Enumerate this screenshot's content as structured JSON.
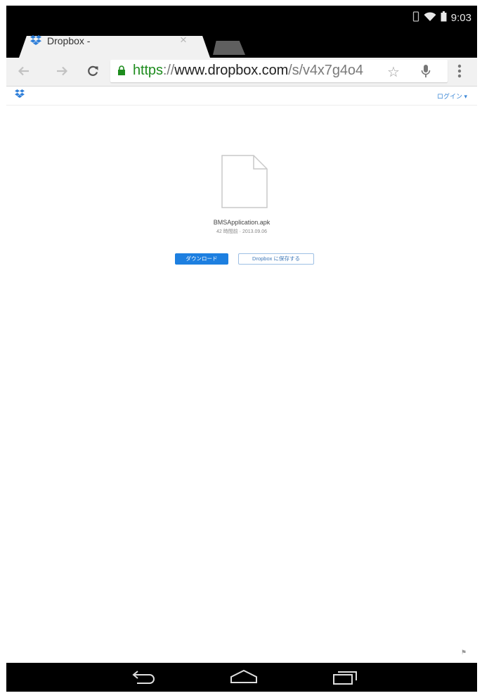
{
  "status_bar": {
    "time": "9:03",
    "icons": [
      "vibrate-icon",
      "wifi-icon",
      "battery-icon"
    ]
  },
  "tab": {
    "title": "Dropbox -",
    "close_glyph": "×"
  },
  "toolbar": {
    "url_scheme": "https",
    "url_sep": "://",
    "url_host": "www.dropbox.com",
    "url_path": "/s/v4x7g4o4",
    "star_glyph": "☆"
  },
  "page": {
    "signin_label": "ログイン ▾",
    "file_name": "BMSApplication.apk",
    "file_meta": "42 時間前 · 2013.09.06",
    "download_label": "ダウンロード",
    "save_label": "Dropbox に保存する",
    "report_flag": "⚑"
  },
  "colors": {
    "accent": "#1d7fe0",
    "url_secure": "#1e8c1e",
    "dropbox_blue": "#2f7fd9"
  }
}
